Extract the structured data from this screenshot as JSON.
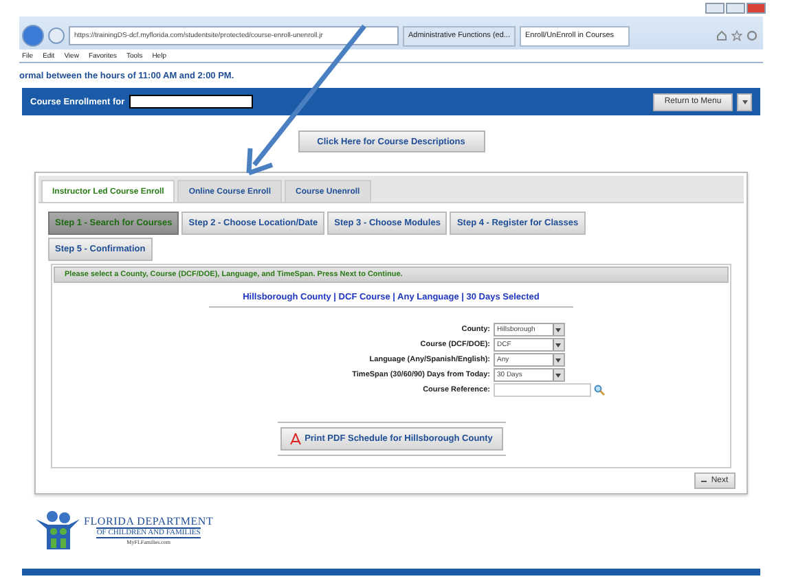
{
  "browser": {
    "address": "https://trainingDS-dcf.myflorida.com/studentsite/protected/course-enroll-unenroll.jr",
    "tabs": [
      {
        "label": "Administrative Functions (ed...",
        "selected": false
      },
      {
        "label": "Enroll/UnEnroll in Courses",
        "selected": true
      }
    ],
    "menu": [
      "File",
      "Edit",
      "View",
      "Favorites",
      "Tools",
      "Help"
    ]
  },
  "notice": "ormal between the hours of 11:00 AM and 2:00 PM.",
  "header": {
    "title": "Course Enrollment for",
    "button": "Return to Menu"
  },
  "descriptions_button": "Click Here for Course Descriptions",
  "tabs": [
    {
      "label": "Instructor Led Course Enroll",
      "selected": true
    },
    {
      "label": "Online Course Enroll",
      "selected": false
    },
    {
      "label": "Course Unenroll",
      "selected": false
    }
  ],
  "steps": [
    {
      "label": "Step 1 - Search for Courses",
      "selected": true
    },
    {
      "label": "Step 2 - Choose Location/Date",
      "selected": false
    },
    {
      "label": "Step 3 - Choose Modules",
      "selected": false
    },
    {
      "label": "Step 4 - Register for Classes",
      "selected": false
    },
    {
      "label": "Step 5 - Confirmation",
      "selected": false
    }
  ],
  "instruction": "Please select a County, Course (DCF/DOE), Language, and TimeSpan. Press Next to Continue.",
  "summary": "Hillsborough County | DCF Course | Any Language | 30 Days Selected",
  "fields": [
    {
      "label": "County:",
      "kind": "select",
      "value": "Hillsborough"
    },
    {
      "label": "Course (DCF/DOE):",
      "kind": "select",
      "value": "DCF"
    },
    {
      "label": "Language (Any/Spanish/English):",
      "kind": "select",
      "value": "Any"
    },
    {
      "label": "TimeSpan (30/60/90) Days from Today:",
      "kind": "select",
      "value": "30 Days"
    },
    {
      "label": "Course Reference:",
      "kind": "search"
    }
  ],
  "print_button": "Print PDF Schedule for Hillsborough County",
  "next_button": "Next",
  "logo": {
    "line1": "FLORIDA DEPARTMENT",
    "line2": "OF CHILDREN AND FAMILIES",
    "line3": "MyFLFamilies.com"
  }
}
